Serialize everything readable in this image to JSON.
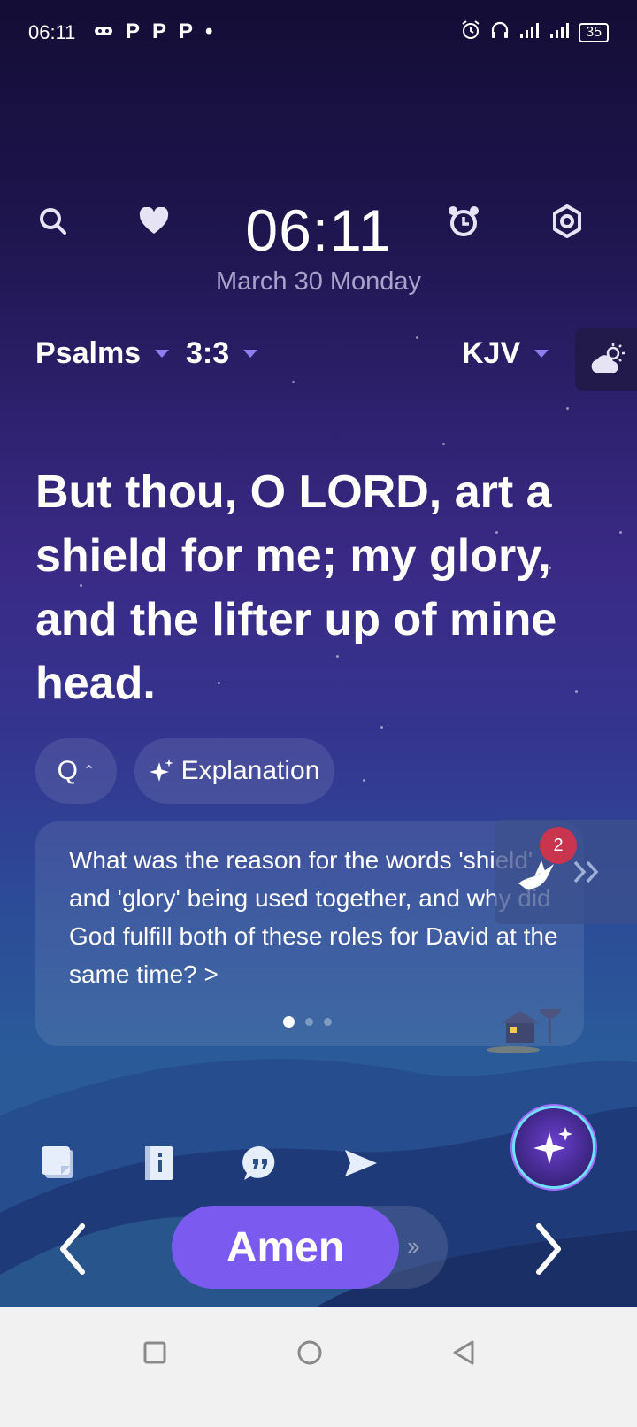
{
  "status_bar": {
    "time": "06:11",
    "notification_icons": [
      "P",
      "P",
      "P"
    ],
    "battery": "35"
  },
  "header": {
    "clock": "06:11",
    "date": "March 30 Monday"
  },
  "selectors": {
    "book": "Psalms",
    "chapter_verse": "3:3",
    "translation": "KJV"
  },
  "verse": {
    "text": "But thou, O LORD, art a shield for me; my glory, and the lifter up of mine head."
  },
  "chips": {
    "q_label": "Q",
    "explanation_label": "Explanation"
  },
  "question_card": {
    "text": "What was the reason for the words 'shield' and 'glory' being used together, and why did God fulfill both of these roles for David at the same time? >",
    "page_count": 3,
    "active_page": 1
  },
  "side_tab": {
    "badge_count": "2"
  },
  "amen": {
    "label": "Amen"
  },
  "colors": {
    "accent": "#7b5bef",
    "badge": "#c9344f"
  }
}
